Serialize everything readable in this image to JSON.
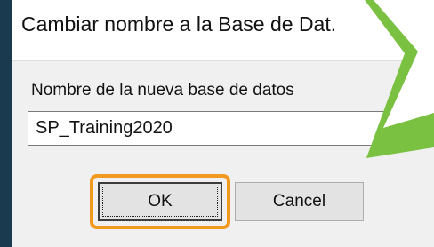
{
  "dialog": {
    "title": "Cambiar nombre a la Base de Dat.",
    "field_label": "Nombre de la nueva base de datos",
    "name_value": "SP_Training2020",
    "ok_label": "OK",
    "cancel_label": "Cancel"
  },
  "colors": {
    "highlight": "#f29a1f",
    "arrow_fill": "#7ac142",
    "page_background": "#1d3f55"
  }
}
